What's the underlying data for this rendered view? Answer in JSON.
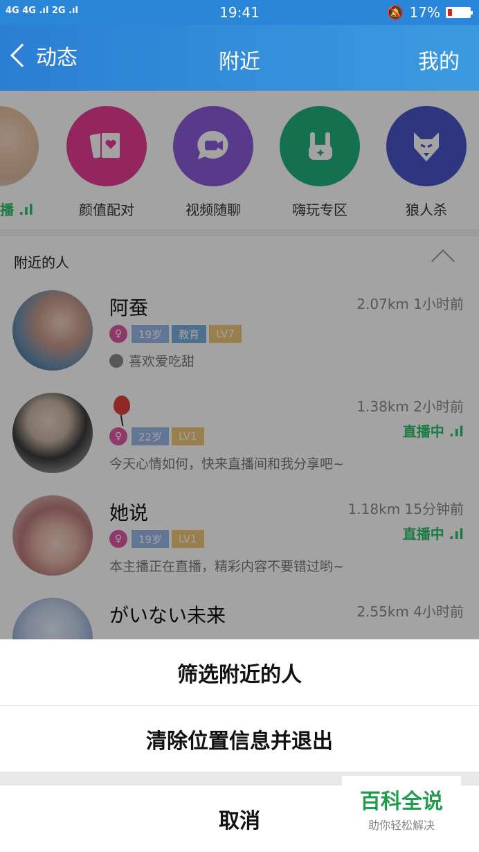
{
  "status_bar": {
    "network": "4G 4G .ıl 2G .ıl",
    "time": "19:41",
    "battery": "17%"
  },
  "nav": {
    "back_label": "动态",
    "title": "附近",
    "right_label": "我的"
  },
  "features": [
    {
      "label": "颜值配对",
      "icon": "cards-heart-icon",
      "color": "#e63b95"
    },
    {
      "label": "视频随聊",
      "icon": "video-chat-icon",
      "color": "#8a59d8"
    },
    {
      "label": "嗨玩专区",
      "icon": "rock-hand-icon",
      "color": "#20b07a"
    },
    {
      "label": "狼人杀",
      "icon": "wolf-icon",
      "color": "#4a55c8"
    }
  ],
  "partial_feature_label": "播 .ıl",
  "section": {
    "title": "附近的人"
  },
  "people": [
    {
      "name": "阿蚕",
      "distance_time": "2.07km 1小时前",
      "age": "19岁",
      "job": "教育",
      "level": "LV7",
      "signature": "喜欢爱吃甜",
      "live": ""
    },
    {
      "name": "",
      "distance_time": "1.38km 2小时前",
      "age": "22岁",
      "job": "",
      "level": "LV1",
      "signature": "今天心情如何，快来直播间和我分享吧~",
      "live": "直播中 .ıl"
    },
    {
      "name": "她说",
      "distance_time": "1.18km 15分钟前",
      "age": "19岁",
      "job": "",
      "level": "LV1",
      "signature": "本主播正在直播，精彩内容不要错过哟~",
      "live": "直播中 .ıl"
    },
    {
      "name": "がいない未来",
      "distance_time": "2.55km 4小时前",
      "age": "",
      "job": "",
      "level": "",
      "signature": "",
      "live": ""
    }
  ],
  "sheet": {
    "filter": "筛选附近的人",
    "clear": "清除位置信息并退出",
    "cancel": "取消"
  },
  "watermark": {
    "title": "百科全说",
    "subtitle": "助你轻松解决"
  }
}
